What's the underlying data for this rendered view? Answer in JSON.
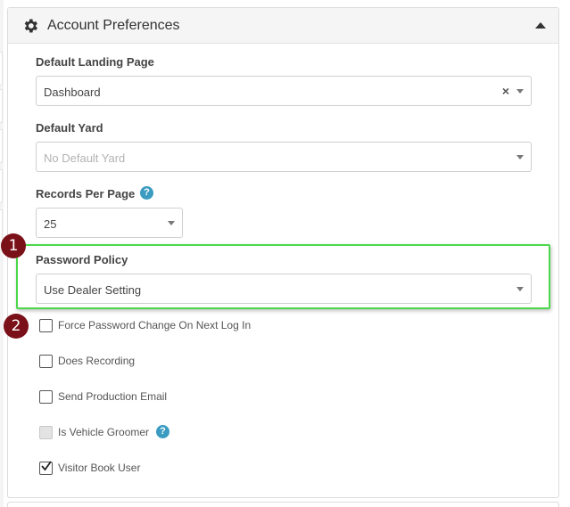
{
  "panel": {
    "title": "Account Preferences",
    "header_icon": "gear-icon",
    "collapse_icon": "caret-up-icon"
  },
  "fields": {
    "landing_page": {
      "label": "Default Landing Page",
      "value": "Dashboard",
      "clear": "×"
    },
    "default_yard": {
      "label": "Default Yard",
      "placeholder": "No Default Yard"
    },
    "records_per_page": {
      "label": "Records Per Page",
      "value": "25",
      "help": "?"
    },
    "password_policy": {
      "label": "Password Policy",
      "value": "Use Dealer Setting"
    }
  },
  "checkboxes": [
    {
      "label": "Force Password Change On Next Log In",
      "checked": false,
      "disabled": false
    },
    {
      "label": "Does Recording",
      "checked": false,
      "disabled": false
    },
    {
      "label": "Send Production Email",
      "checked": false,
      "disabled": false
    },
    {
      "label": "Is Vehicle Groomer",
      "checked": false,
      "disabled": true,
      "help": "?"
    },
    {
      "label": "Visitor Book User",
      "checked": true,
      "disabled": false
    }
  ],
  "markers": [
    "1",
    "2"
  ],
  "colors": {
    "highlight": "#4cd84c",
    "marker": "#7a1018",
    "help": "#3b9bc1"
  }
}
